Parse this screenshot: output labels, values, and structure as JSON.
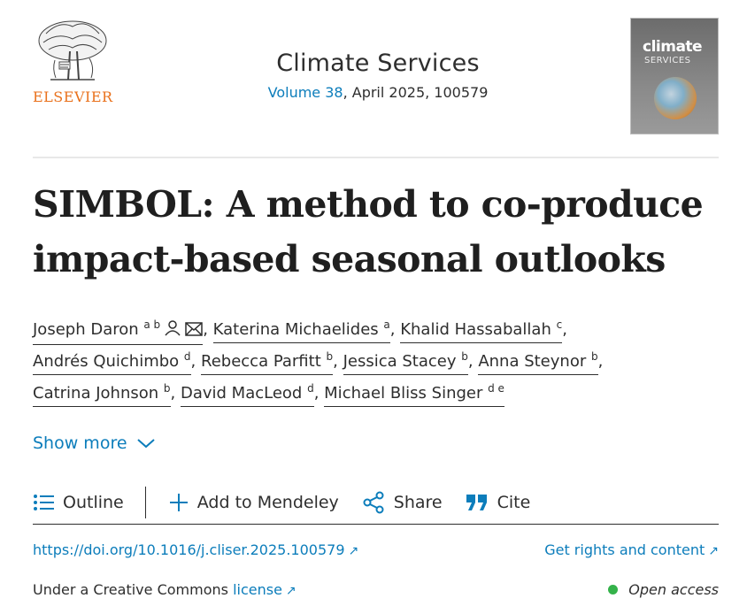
{
  "header": {
    "publisher": "ELSEVIER",
    "journal_title": "Climate Services",
    "volume_link": "Volume 38",
    "issue_rest": ", April 2025, 100579",
    "cover": {
      "line1": "climate",
      "line2": "SERVICES"
    }
  },
  "article": {
    "title_line1": "SIMBOL: A method to co-produce",
    "title_line2": "impact-based seasonal outlooks"
  },
  "authors": [
    {
      "name": "Joseph Daron",
      "affil": "a b"
    },
    {
      "name": "Katerina Michaelides",
      "affil": "a"
    },
    {
      "name": "Khalid Hassaballah",
      "affil": "c"
    },
    {
      "name": "Andrés Quichimbo",
      "affil": "d"
    },
    {
      "name": "Rebecca Parfitt",
      "affil": "b"
    },
    {
      "name": "Jessica Stacey",
      "affil": "b"
    },
    {
      "name": "Anna Steynor",
      "affil": "b"
    },
    {
      "name": "Catrina Johnson",
      "affil": "b"
    },
    {
      "name": "David MacLeod",
      "affil": "d"
    },
    {
      "name": "Michael Bliss Singer",
      "affil": "d e"
    }
  ],
  "show_more": "Show more",
  "toolbar": {
    "outline": "Outline",
    "mendeley": "Add to Mendeley",
    "share": "Share",
    "cite": "Cite"
  },
  "links": {
    "doi": "https://doi.org/10.1016/j.cliser.2025.100579",
    "rights": "Get rights and content",
    "cc_prefix": "Under a Creative Commons ",
    "cc_link": "license",
    "open_access": "Open access"
  },
  "colors": {
    "accent": "#0c7dbb",
    "brand": "#e9711c",
    "open": "#34b24a"
  }
}
